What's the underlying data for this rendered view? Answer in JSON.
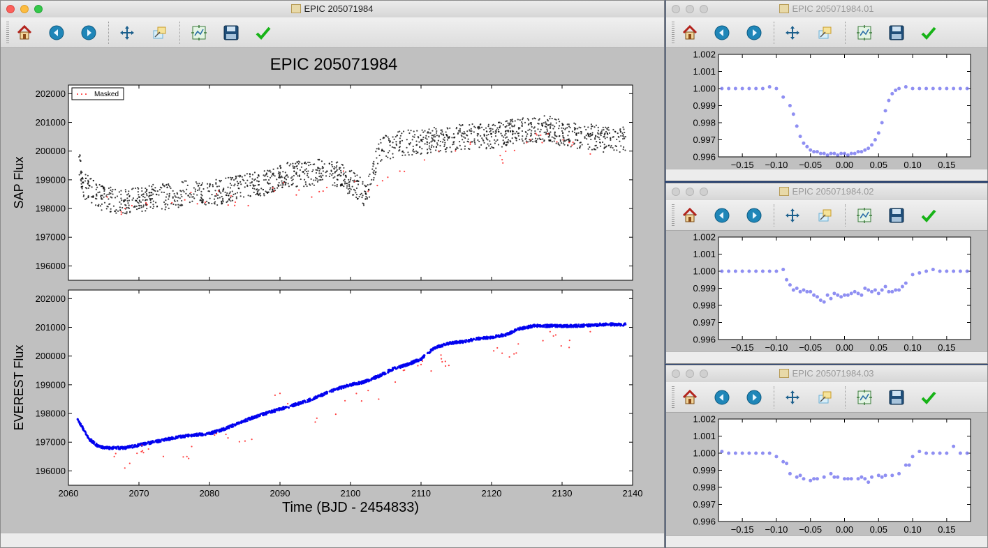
{
  "main_window": {
    "title": "EPIC 205071984",
    "figure_title": "EPIC 205071984",
    "legend_label": "Masked"
  },
  "toolbar": {
    "buttons": [
      "home-icon",
      "back-icon",
      "forward-icon",
      "pan-icon",
      "zoom-icon",
      "subplots-icon",
      "save-icon",
      "check-icon"
    ]
  },
  "side_windows": [
    {
      "title": "EPIC 205071984.01"
    },
    {
      "title": "EPIC 205071984.02"
    },
    {
      "title": "EPIC 205071984.03"
    }
  ],
  "colors": {
    "raw": "#000000",
    "masked": "#ff2020",
    "everest": "#0000ee",
    "fold": "#7b7bf0"
  },
  "chart_data": [
    {
      "type": "scatter",
      "title": "EPIC 205071984",
      "xlabel": "",
      "ylabel": "SAP Flux",
      "xlim": [
        2060,
        2140
      ],
      "ylim": [
        195500,
        202300
      ],
      "yticks": [
        196000,
        197000,
        198000,
        199000,
        200000,
        201000,
        202000
      ],
      "ytick_labels": [
        "196000",
        "197000",
        "198000",
        "199000",
        "200000",
        "201000",
        "202000"
      ],
      "legend": [
        "Masked"
      ],
      "legend_position": "upper-left",
      "series": [
        {
          "name": "",
          "color": "#000000",
          "x": [
            2061.5,
            2062.0,
            2063.0,
            2064.0,
            2066.0,
            2068.0,
            2070.0,
            2072.0,
            2074.0,
            2076.0,
            2078.0,
            2080.0,
            2082.0,
            2084.0,
            2086.0,
            2088.0,
            2090.0,
            2092.0,
            2094.0,
            2096.0,
            2098.0,
            2100.0,
            2102.0,
            2103.0,
            2104.0,
            2106.0,
            2108.0,
            2110.0,
            2112.0,
            2114.0,
            2116.0,
            2118.0,
            2120.0,
            2122.0,
            2124.0,
            2126.0,
            2128.0,
            2130.0,
            2132.0,
            2134.0,
            2136.0,
            2138.0,
            2139.0
          ],
          "y": [
            199800,
            198900,
            198800,
            198500,
            198400,
            198300,
            198400,
            198500,
            198500,
            198600,
            198600,
            198600,
            198700,
            198800,
            198900,
            199000,
            199200,
            199300,
            199300,
            199400,
            199300,
            199000,
            198600,
            199000,
            200100,
            200300,
            200400,
            200400,
            200500,
            200500,
            200600,
            200600,
            200600,
            200700,
            200800,
            200800,
            200900,
            200700,
            200600,
            200600,
            200500,
            200500,
            200500
          ]
        },
        {
          "name": "Masked",
          "color": "#ff2020",
          "x": [
            2065.5,
            2067.5,
            2069.0,
            2071.0,
            2076.5,
            2081.0,
            2085.5,
            2090.5,
            2094.5,
            2099.0,
            2102.5,
            2103.8,
            2107.0,
            2112.5,
            2117.0,
            2121.5,
            2128.0,
            2131.0,
            2134.0
          ],
          "y": [
            198400,
            197800,
            198100,
            198200,
            198300,
            198500,
            198100,
            198900,
            198400,
            199300,
            198600,
            198800,
            199300,
            200000,
            200300,
            199700,
            200600,
            200300,
            199900
          ]
        }
      ]
    },
    {
      "type": "scatter",
      "title": "",
      "xlabel": "Time (BJD - 2454833)",
      "ylabel": "EVEREST Flux",
      "xlim": [
        2060,
        2140
      ],
      "ylim": [
        195500,
        202300
      ],
      "xticks": [
        2060,
        2070,
        2080,
        2090,
        2100,
        2110,
        2120,
        2130,
        2140
      ],
      "xtick_labels": [
        "2060",
        "2070",
        "2080",
        "2090",
        "2100",
        "2110",
        "2120",
        "2130",
        "2140"
      ],
      "yticks": [
        196000,
        197000,
        198000,
        199000,
        200000,
        201000,
        202000
      ],
      "ytick_labels": [
        "196000",
        "197000",
        "198000",
        "199000",
        "200000",
        "201000",
        "202000"
      ],
      "series": [
        {
          "name": "",
          "color": "#0000ee",
          "x": [
            2061.3,
            2062.0,
            2063.0,
            2064.0,
            2065.0,
            2066.0,
            2068.0,
            2070.0,
            2072.0,
            2074.0,
            2076.0,
            2078.0,
            2080.0,
            2082.0,
            2084.0,
            2086.0,
            2088.0,
            2090.0,
            2092.0,
            2094.0,
            2096.0,
            2098.0,
            2100.0,
            2102.0,
            2104.0,
            2106.0,
            2108.0,
            2110.0,
            2112.0,
            2114.0,
            2116.0,
            2118.0,
            2120.0,
            2122.0,
            2124.0,
            2126.0,
            2128.0,
            2130.0,
            2132.0,
            2134.0,
            2136.0,
            2138.0,
            2139.0
          ],
          "y": [
            197800,
            197500,
            197100,
            196900,
            196800,
            196800,
            196800,
            196900,
            197000,
            197100,
            197200,
            197250,
            197300,
            197450,
            197650,
            197850,
            198000,
            198150,
            198300,
            198450,
            198650,
            198850,
            199000,
            199100,
            199300,
            199550,
            199700,
            199900,
            200300,
            200450,
            200500,
            200600,
            200650,
            200750,
            200950,
            201050,
            201050,
            201050,
            201050,
            201080,
            201100,
            201100,
            201100
          ]
        },
        {
          "name": "Masked",
          "color": "#ff2020",
          "x": [
            2066.5,
            2068.0,
            2070.5,
            2076.8,
            2081.0,
            2086.0,
            2090.0,
            2095.0,
            2102.5,
            2104.0,
            2107.5,
            2113.0,
            2121.5,
            2128.3,
            2131.0,
            2134.0
          ],
          "y": [
            196500,
            196100,
            196700,
            196500,
            197300,
            197100,
            198700,
            197700,
            198800,
            198500,
            199500,
            199800,
            200100,
            200850,
            200300,
            200850
          ]
        }
      ]
    },
    {
      "type": "scatter",
      "title": "",
      "xlabel": "",
      "ylabel": "",
      "xlim": [
        -0.185,
        0.185
      ],
      "ylim": [
        0.996,
        1.002
      ],
      "xticks": [
        -0.15,
        -0.1,
        -0.05,
        0.0,
        0.05,
        0.1,
        0.15
      ],
      "xtick_labels": [
        "−0.15",
        "−0.10",
        "−0.05",
        "0.00",
        "0.05",
        "0.10",
        "0.15"
      ],
      "yticks": [
        0.996,
        0.997,
        0.998,
        0.999,
        1.0,
        1.001,
        1.002
      ],
      "ytick_labels": [
        "0.996",
        "0.997",
        "0.998",
        "0.999",
        "1.000",
        "1.001",
        "1.002"
      ],
      "series": [
        {
          "name": "",
          "color": "#7b7bf0",
          "x": [
            -0.18,
            -0.17,
            -0.16,
            -0.15,
            -0.14,
            -0.13,
            -0.12,
            -0.11,
            -0.1,
            -0.09,
            -0.08,
            -0.075,
            -0.07,
            -0.065,
            -0.06,
            -0.055,
            -0.05,
            -0.045,
            -0.04,
            -0.035,
            -0.03,
            -0.025,
            -0.02,
            -0.015,
            -0.01,
            -0.005,
            0.0,
            0.005,
            0.01,
            0.015,
            0.02,
            0.025,
            0.03,
            0.035,
            0.04,
            0.045,
            0.05,
            0.055,
            0.06,
            0.065,
            0.07,
            0.075,
            0.08,
            0.09,
            0.1,
            0.11,
            0.12,
            0.13,
            0.14,
            0.15,
            0.16,
            0.17,
            0.18
          ],
          "y": [
            1.0,
            1.0,
            1.0,
            1.0,
            1.0,
            1.0,
            1.0,
            1.0001,
            1.0,
            0.9995,
            0.999,
            0.9985,
            0.9978,
            0.9972,
            0.9968,
            0.9966,
            0.9964,
            0.9963,
            0.9963,
            0.9962,
            0.9962,
            0.9961,
            0.9962,
            0.9962,
            0.9961,
            0.9962,
            0.9962,
            0.9961,
            0.9962,
            0.9962,
            0.9963,
            0.9963,
            0.9964,
            0.9965,
            0.9967,
            0.997,
            0.9974,
            0.998,
            0.9987,
            0.9993,
            0.9997,
            0.9999,
            1.0,
            1.0001,
            1.0,
            1.0,
            1.0,
            1.0,
            1.0,
            1.0,
            1.0,
            1.0,
            1.0
          ]
        }
      ]
    },
    {
      "type": "scatter",
      "title": "",
      "xlabel": "",
      "ylabel": "",
      "xlim": [
        -0.185,
        0.185
      ],
      "ylim": [
        0.996,
        1.002
      ],
      "xticks": [
        -0.15,
        -0.1,
        -0.05,
        0.0,
        0.05,
        0.1,
        0.15
      ],
      "xtick_labels": [
        "−0.15",
        "−0.10",
        "−0.05",
        "0.00",
        "0.05",
        "0.10",
        "0.15"
      ],
      "yticks": [
        0.996,
        0.997,
        0.998,
        0.999,
        1.0,
        1.001,
        1.002
      ],
      "ytick_labels": [
        "0.996",
        "0.997",
        "0.998",
        "0.999",
        "1.000",
        "1.001",
        "1.002"
      ],
      "series": [
        {
          "name": "",
          "color": "#7b7bf0",
          "x": [
            -0.18,
            -0.17,
            -0.16,
            -0.15,
            -0.14,
            -0.13,
            -0.12,
            -0.11,
            -0.1,
            -0.09,
            -0.085,
            -0.08,
            -0.075,
            -0.07,
            -0.065,
            -0.06,
            -0.055,
            -0.05,
            -0.045,
            -0.04,
            -0.035,
            -0.03,
            -0.025,
            -0.02,
            -0.015,
            -0.01,
            -0.005,
            0.0,
            0.005,
            0.01,
            0.015,
            0.02,
            0.025,
            0.03,
            0.035,
            0.04,
            0.045,
            0.05,
            0.055,
            0.06,
            0.065,
            0.07,
            0.075,
            0.08,
            0.085,
            0.09,
            0.1,
            0.11,
            0.12,
            0.13,
            0.14,
            0.15,
            0.16,
            0.17,
            0.18
          ],
          "y": [
            1.0,
            1.0,
            1.0,
            1.0,
            1.0,
            1.0,
            1.0,
            1.0,
            1.0,
            1.0001,
            0.9995,
            0.9992,
            0.9989,
            0.999,
            0.9988,
            0.9989,
            0.9988,
            0.9988,
            0.9986,
            0.9985,
            0.9983,
            0.9982,
            0.9986,
            0.9984,
            0.9987,
            0.9986,
            0.9985,
            0.9986,
            0.9986,
            0.9987,
            0.9988,
            0.9987,
            0.9986,
            0.999,
            0.9989,
            0.9988,
            0.9989,
            0.9987,
            0.9989,
            0.9991,
            0.9988,
            0.9988,
            0.9989,
            0.9989,
            0.9991,
            0.9993,
            0.9998,
            0.9999,
            1.0,
            1.0001,
            1.0,
            1.0,
            1.0,
            1.0,
            1.0
          ]
        }
      ]
    },
    {
      "type": "scatter",
      "title": "",
      "xlabel": "",
      "ylabel": "",
      "xlim": [
        -0.185,
        0.185
      ],
      "ylim": [
        0.996,
        1.002
      ],
      "xticks": [
        -0.15,
        -0.1,
        -0.05,
        0.0,
        0.05,
        0.1,
        0.15
      ],
      "xtick_labels": [
        "−0.15",
        "−0.10",
        "−0.05",
        "0.00",
        "0.05",
        "0.10",
        "0.15"
      ],
      "yticks": [
        0.996,
        0.997,
        0.998,
        0.999,
        1.0,
        1.001,
        1.002
      ],
      "ytick_labels": [
        "0.996",
        "0.997",
        "0.998",
        "0.999",
        "1.000",
        "1.001",
        "1.002"
      ],
      "series": [
        {
          "name": "",
          "color": "#7b7bf0",
          "x": [
            -0.18,
            -0.17,
            -0.16,
            -0.15,
            -0.14,
            -0.13,
            -0.12,
            -0.11,
            -0.1,
            -0.09,
            -0.085,
            -0.08,
            -0.07,
            -0.065,
            -0.06,
            -0.05,
            -0.045,
            -0.04,
            -0.03,
            -0.02,
            -0.015,
            -0.01,
            0.0,
            0.005,
            0.01,
            0.02,
            0.025,
            0.03,
            0.035,
            0.04,
            0.05,
            0.055,
            0.06,
            0.07,
            0.08,
            0.09,
            0.095,
            0.1,
            0.11,
            0.12,
            0.13,
            0.14,
            0.15,
            0.16,
            0.17,
            0.18
          ],
          "y": [
            1.0001,
            1.0,
            1.0,
            1.0,
            1.0,
            1.0,
            1.0,
            1.0,
            0.9998,
            0.9995,
            0.9994,
            0.9988,
            0.9986,
            0.9987,
            0.9985,
            0.9984,
            0.9985,
            0.9985,
            0.9986,
            0.9988,
            0.9986,
            0.9986,
            0.9985,
            0.9985,
            0.9985,
            0.9985,
            0.9986,
            0.9985,
            0.9983,
            0.9986,
            0.9987,
            0.9986,
            0.9987,
            0.9987,
            0.9988,
            0.9993,
            0.9993,
            0.9998,
            1.0001,
            1.0,
            1.0,
            1.0,
            1.0,
            1.0004,
            1.0,
            1.0
          ]
        }
      ]
    }
  ]
}
